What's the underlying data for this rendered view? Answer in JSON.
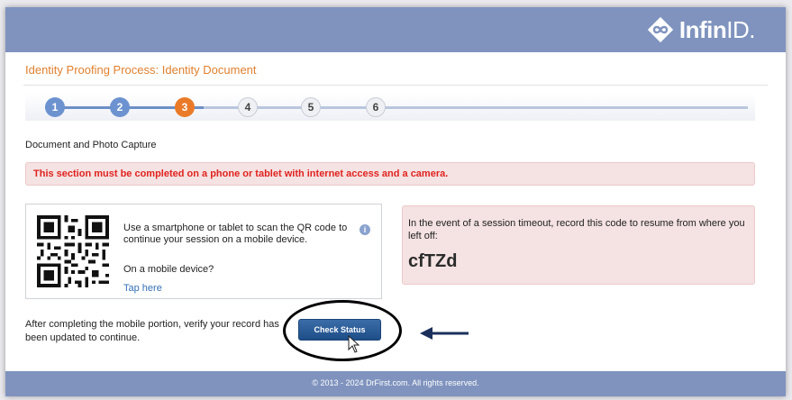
{
  "brand": {
    "logo_text_bold": "Infin",
    "logo_text_light": "ID."
  },
  "header": {
    "title": "Identity Proofing Process: Identity Document"
  },
  "stepper": {
    "steps": [
      {
        "label": "1",
        "status": "done"
      },
      {
        "label": "2",
        "status": "done"
      },
      {
        "label": "3",
        "status": "current"
      },
      {
        "label": "4",
        "status": "todo"
      },
      {
        "label": "5",
        "status": "todo"
      },
      {
        "label": "6",
        "status": "todo"
      }
    ]
  },
  "section": {
    "label": "Document and Photo Capture",
    "alert": "This section must be completed on a phone or tablet with internet access and a camera."
  },
  "qr_panel": {
    "description": "Use a smartphone or tablet to scan the QR code to continue your session on a mobile device.",
    "mobile_question": "On a mobile device?",
    "tap_here": "Tap here",
    "info_icon": "info-icon"
  },
  "session_code": {
    "description": "In the event of a session timeout, record this code to resume from where you left off:",
    "code": "cfTZd"
  },
  "verify": {
    "text": "After completing the mobile portion, verify your record has been updated to continue.",
    "button_label": "Check Status"
  },
  "footer": {
    "copyright": "© 2013 - 2024 DrFirst.com. All rights reserved."
  },
  "colors": {
    "header": "#7f93be",
    "accent_orange": "#ea7a28",
    "step_done": "#6c93cf",
    "alert_text": "#e0231f",
    "button": "#2a5d99"
  }
}
